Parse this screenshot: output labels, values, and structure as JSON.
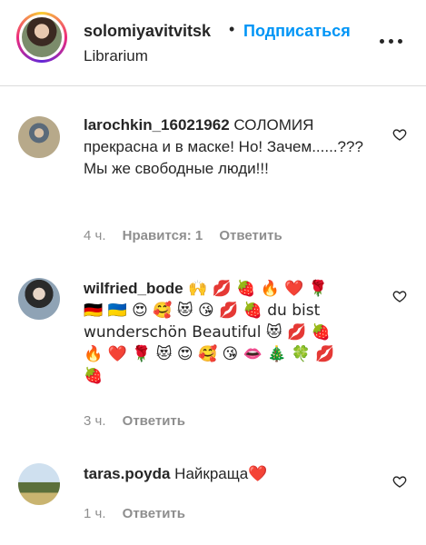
{
  "header": {
    "username": "solomiyavitvitsk",
    "separator": "•",
    "follow_label": "Подписаться",
    "location": "Librarium",
    "more_icon": "more-options-icon"
  },
  "comments": [
    {
      "username": "larochkin_16021962",
      "text": " СОЛОМИЯ прекрасна и в маске! Но! Зачем......??? Мы же свободные люди!!!",
      "time": "4 ч.",
      "likes_label": "Нравится: 1",
      "reply_label": "Ответить"
    },
    {
      "username": "wilfried_bode",
      "text_line1": " 🙌 💋 🍓 🔥 ❤️ 🌹",
      "text_line2": "🇩🇪 🇺🇦 😍 🥰 😻 😘 💋 🍓 du bist",
      "text_line3": "wunderschön Beautiful 😻 💋 🍓",
      "text_line4": "🔥 ❤️ 🌹 😻 😍 🥰 😘 👄 🎄 🍀 💋",
      "text_line5": "🍓",
      "time": "3 ч.",
      "reply_label": "Ответить"
    },
    {
      "username": "taras.poyda",
      "text": " Найкраща❤️",
      "time": "1 ч.",
      "reply_label": "Ответить"
    }
  ],
  "colors": {
    "link": "#0095f6",
    "meta": "#8e8e8e",
    "text": "#262626"
  }
}
